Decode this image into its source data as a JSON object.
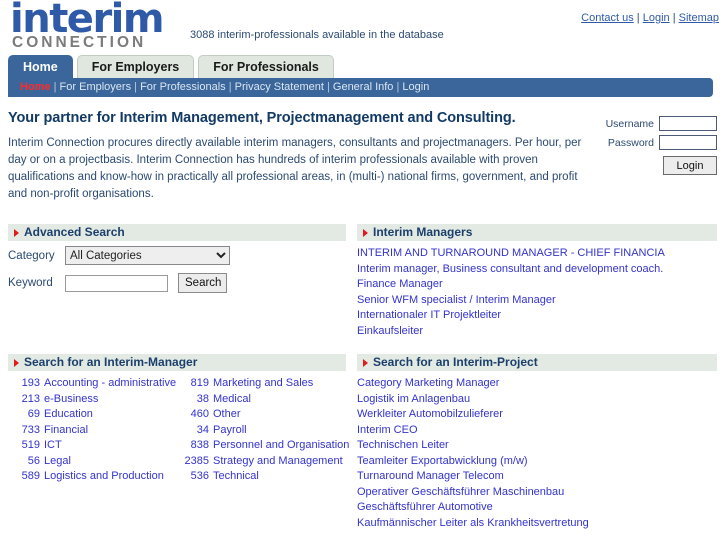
{
  "header": {
    "logo_word": "interim",
    "logo_sub": "CONNECTION",
    "tagline": "3088 interim-professionals available in the database",
    "toplinks": [
      {
        "label": "Contact us"
      },
      {
        "label": "Login"
      },
      {
        "label": "Sitemap"
      }
    ],
    "link_separator": "|"
  },
  "tabs": [
    {
      "label": "Home",
      "active": true
    },
    {
      "label": "For Employers",
      "active": false
    },
    {
      "label": "For Professionals",
      "active": false
    }
  ],
  "navstrip": {
    "items": [
      {
        "label": "Home",
        "current": true
      },
      {
        "label": "For Employers",
        "current": false
      },
      {
        "label": "For Professionals",
        "current": false
      },
      {
        "label": "Privacy Statement",
        "current": false
      },
      {
        "label": "General Info",
        "current": false
      },
      {
        "label": "Login",
        "current": false
      }
    ],
    "separator": "|"
  },
  "intro": {
    "title": "Your partner for Interim Management, Projectmanagement and Consulting.",
    "body": "Interim Connection procures directly available interim managers, consultants and projectmanagers. Per hour, per day or on a projectbasis. Interim Connection has hundreds of interim professionals available with proven qualifications and know-how in practically all professional areas, in (multi-) national firms, government, and profit and non-profit organisations."
  },
  "login": {
    "username_label": "Username",
    "username_value": "",
    "password_label": "Password",
    "password_value": "",
    "button_label": "Login"
  },
  "advanced_search": {
    "heading": "Advanced Search",
    "category_label": "Category",
    "category_selected": "All Categories",
    "category_options": [
      "All Categories"
    ],
    "keyword_label": "Keyword",
    "keyword_value": "",
    "search_button": "Search"
  },
  "interim_managers": {
    "heading": "Interim Managers",
    "items": [
      "INTERIM AND TURNAROUND MANAGER - CHIEF FINANCIA",
      "Interim manager, Business consultant and development coach.",
      "Finance Manager",
      "Senior WFM specialist / Interim Manager",
      "Internationaler IT Projektleiter",
      "Einkaufsleiter"
    ]
  },
  "search_manager": {
    "heading": "Search for an Interim-Manager",
    "left_column": [
      {
        "count": "193",
        "name": "Accounting - administrative"
      },
      {
        "count": "213",
        "name": "e-Business"
      },
      {
        "count": "69",
        "name": "Education"
      },
      {
        "count": "733",
        "name": "Financial"
      },
      {
        "count": "519",
        "name": "ICT"
      },
      {
        "count": "56",
        "name": "Legal"
      },
      {
        "count": "589",
        "name": "Logistics and Production"
      }
    ],
    "right_column": [
      {
        "count": "819",
        "name": "Marketing and Sales"
      },
      {
        "count": "38",
        "name": "Medical"
      },
      {
        "count": "460",
        "name": "Other"
      },
      {
        "count": "34",
        "name": "Payroll"
      },
      {
        "count": "838",
        "name": "Personnel and Organisation"
      },
      {
        "count": "2385",
        "name": "Strategy and Management"
      },
      {
        "count": "536",
        "name": "Technical"
      }
    ]
  },
  "search_project": {
    "heading": "Search for an Interim-Project",
    "items": [
      "Category Marketing Manager",
      "Logistik im Anlagenbau",
      "Werkleiter Automobilzulieferer",
      "Interim CEO",
      "Technischen Leiter",
      "Teamleiter Exportabwicklung (m/w)",
      "Turnaround Manager Telecom",
      "Operativer Geschäftsführer Maschinenbau",
      "Geschäftsführer Automotive",
      "Kaufmännischer Leiter als Krankheitsvertretung"
    ]
  },
  "colors": {
    "brand_blue": "#2f5aa8",
    "nav_blue": "#3a669b",
    "panel_head_bg": "#e3eae3",
    "link_blue": "#3333cc",
    "accent_red": "#e01b1b",
    "current_red": "#ff2a2a",
    "logo_gray": "#7b7b7b"
  }
}
